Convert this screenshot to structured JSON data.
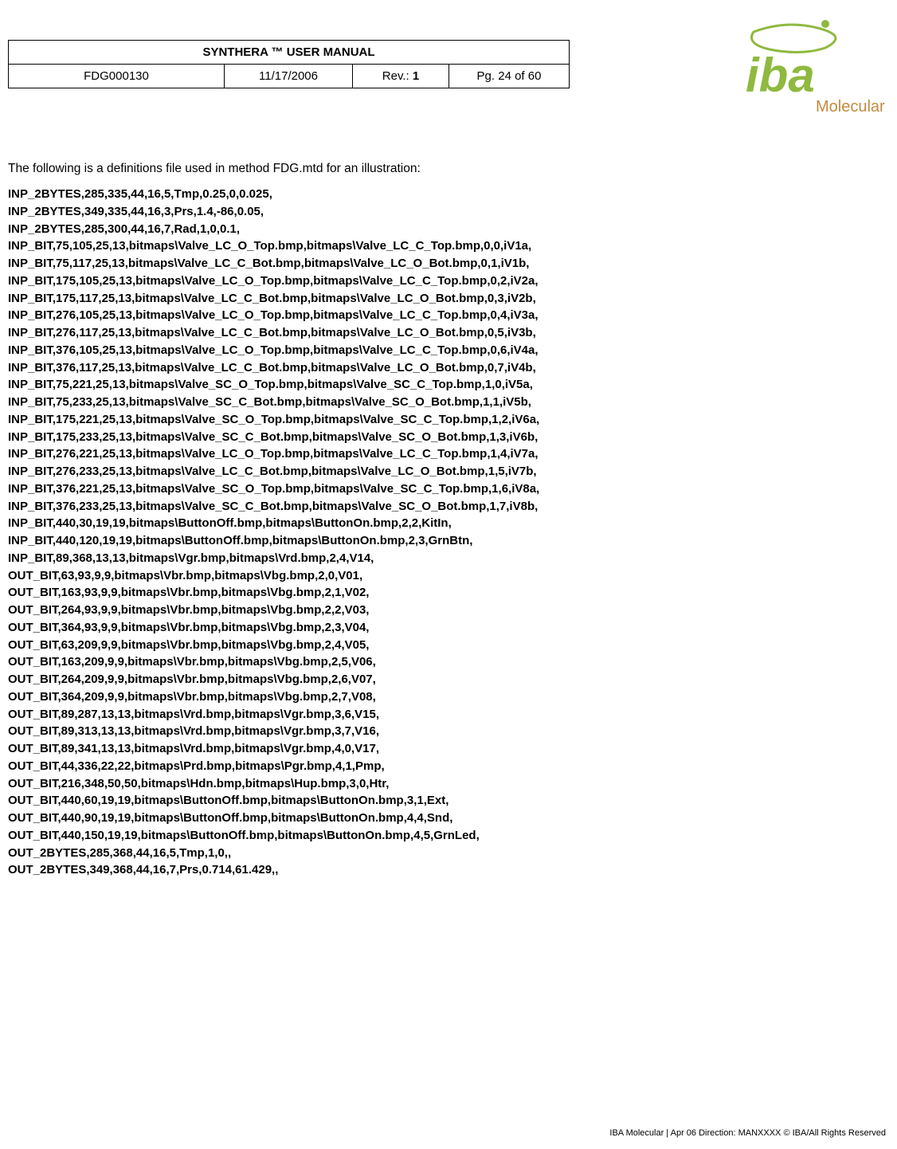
{
  "header": {
    "title": "SYNTHERA ™ USER MANUAL",
    "doc_id": "FDG000130",
    "date": "11/17/2006",
    "rev_label": "Rev.:",
    "rev_value": "1",
    "page": "Pg. 24 of 60"
  },
  "logo": {
    "brand": "iba",
    "sub": "Molecular"
  },
  "intro": "The following is a definitions file used in method FDG.mtd for an illustration:",
  "defs": [
    "INP_2BYTES,285,335,44,16,5,Tmp,0.25,0,0.025,",
    "INP_2BYTES,349,335,44,16,3,Prs,1.4,-86,0.05,",
    "INP_2BYTES,285,300,44,16,7,Rad,1,0,0.1,",
    "INP_BIT,75,105,25,13,bitmaps\\Valve_LC_O_Top.bmp,bitmaps\\Valve_LC_C_Top.bmp,0,0,iV1a,",
    "INP_BIT,75,117,25,13,bitmaps\\Valve_LC_C_Bot.bmp,bitmaps\\Valve_LC_O_Bot.bmp,0,1,iV1b,",
    "INP_BIT,175,105,25,13,bitmaps\\Valve_LC_O_Top.bmp,bitmaps\\Valve_LC_C_Top.bmp,0,2,iV2a,",
    "INP_BIT,175,117,25,13,bitmaps\\Valve_LC_C_Bot.bmp,bitmaps\\Valve_LC_O_Bot.bmp,0,3,iV2b,",
    "INP_BIT,276,105,25,13,bitmaps\\Valve_LC_O_Top.bmp,bitmaps\\Valve_LC_C_Top.bmp,0,4,iV3a,",
    "INP_BIT,276,117,25,13,bitmaps\\Valve_LC_C_Bot.bmp,bitmaps\\Valve_LC_O_Bot.bmp,0,5,iV3b,",
    "INP_BIT,376,105,25,13,bitmaps\\Valve_LC_O_Top.bmp,bitmaps\\Valve_LC_C_Top.bmp,0,6,iV4a,",
    "INP_BIT,376,117,25,13,bitmaps\\Valve_LC_C_Bot.bmp,bitmaps\\Valve_LC_O_Bot.bmp,0,7,iV4b,",
    "INP_BIT,75,221,25,13,bitmaps\\Valve_SC_O_Top.bmp,bitmaps\\Valve_SC_C_Top.bmp,1,0,iV5a,",
    "INP_BIT,75,233,25,13,bitmaps\\Valve_SC_C_Bot.bmp,bitmaps\\Valve_SC_O_Bot.bmp,1,1,iV5b,",
    "INP_BIT,175,221,25,13,bitmaps\\Valve_SC_O_Top.bmp,bitmaps\\Valve_SC_C_Top.bmp,1,2,iV6a,",
    "INP_BIT,175,233,25,13,bitmaps\\Valve_SC_C_Bot.bmp,bitmaps\\Valve_SC_O_Bot.bmp,1,3,iV6b,",
    "INP_BIT,276,221,25,13,bitmaps\\Valve_LC_O_Top.bmp,bitmaps\\Valve_LC_C_Top.bmp,1,4,iV7a,",
    "INP_BIT,276,233,25,13,bitmaps\\Valve_LC_C_Bot.bmp,bitmaps\\Valve_LC_O_Bot.bmp,1,5,iV7b,",
    "INP_BIT,376,221,25,13,bitmaps\\Valve_SC_O_Top.bmp,bitmaps\\Valve_SC_C_Top.bmp,1,6,iV8a,",
    "INP_BIT,376,233,25,13,bitmaps\\Valve_SC_C_Bot.bmp,bitmaps\\Valve_SC_O_Bot.bmp,1,7,iV8b,",
    "INP_BIT,440,30,19,19,bitmaps\\ButtonOff.bmp,bitmaps\\ButtonOn.bmp,2,2,KitIn,",
    "INP_BIT,440,120,19,19,bitmaps\\ButtonOff.bmp,bitmaps\\ButtonOn.bmp,2,3,GrnBtn,",
    "INP_BIT,89,368,13,13,bitmaps\\Vgr.bmp,bitmaps\\Vrd.bmp,2,4,V14,",
    "OUT_BIT,63,93,9,9,bitmaps\\Vbr.bmp,bitmaps\\Vbg.bmp,2,0,V01,",
    "OUT_BIT,163,93,9,9,bitmaps\\Vbr.bmp,bitmaps\\Vbg.bmp,2,1,V02,",
    "OUT_BIT,264,93,9,9,bitmaps\\Vbr.bmp,bitmaps\\Vbg.bmp,2,2,V03,",
    "OUT_BIT,364,93,9,9,bitmaps\\Vbr.bmp,bitmaps\\Vbg.bmp,2,3,V04,",
    "OUT_BIT,63,209,9,9,bitmaps\\Vbr.bmp,bitmaps\\Vbg.bmp,2,4,V05,",
    "OUT_BIT,163,209,9,9,bitmaps\\Vbr.bmp,bitmaps\\Vbg.bmp,2,5,V06,",
    "OUT_BIT,264,209,9,9,bitmaps\\Vbr.bmp,bitmaps\\Vbg.bmp,2,6,V07,",
    "OUT_BIT,364,209,9,9,bitmaps\\Vbr.bmp,bitmaps\\Vbg.bmp,2,7,V08,",
    "OUT_BIT,89,287,13,13,bitmaps\\Vrd.bmp,bitmaps\\Vgr.bmp,3,6,V15,",
    "OUT_BIT,89,313,13,13,bitmaps\\Vrd.bmp,bitmaps\\Vgr.bmp,3,7,V16,",
    "OUT_BIT,89,341,13,13,bitmaps\\Vrd.bmp,bitmaps\\Vgr.bmp,4,0,V17,",
    "OUT_BIT,44,336,22,22,bitmaps\\Prd.bmp,bitmaps\\Pgr.bmp,4,1,Pmp,",
    "OUT_BIT,216,348,50,50,bitmaps\\Hdn.bmp,bitmaps\\Hup.bmp,3,0,Htr,",
    "OUT_BIT,440,60,19,19,bitmaps\\ButtonOff.bmp,bitmaps\\ButtonOn.bmp,3,1,Ext,",
    "OUT_BIT,440,90,19,19,bitmaps\\ButtonOff.bmp,bitmaps\\ButtonOn.bmp,4,4,Snd,",
    "OUT_BIT,440,150,19,19,bitmaps\\ButtonOff.bmp,bitmaps\\ButtonOn.bmp,4,5,GrnLed,",
    "OUT_2BYTES,285,368,44,16,5,Tmp,1,0,,",
    "OUT_2BYTES,349,368,44,16,7,Prs,0.714,61.429,,"
  ],
  "footer": "IBA Molecular | Apr 06 Direction: MANXXXX © IBA/All Rights Reserved"
}
